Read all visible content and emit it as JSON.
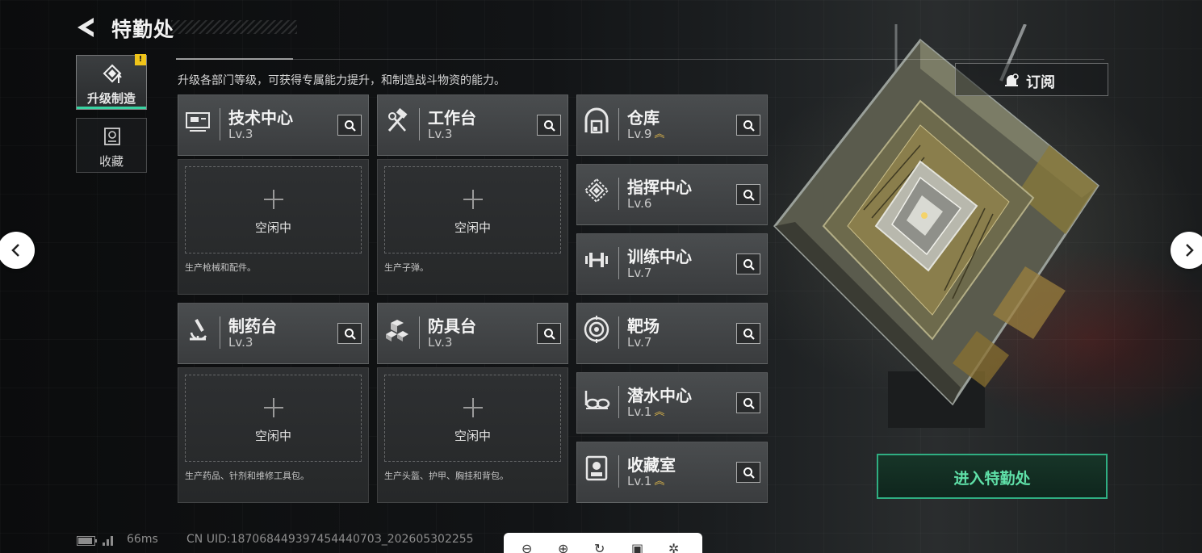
{
  "header": {
    "title": "特勤处",
    "back_icon": "back-chevron-icon"
  },
  "tabs": [
    {
      "label": "升级制造",
      "icon": "upgrade-build-icon",
      "active": true,
      "alert": "!"
    },
    {
      "label": "收藏",
      "icon": "collection-icon",
      "active": false
    }
  ],
  "subtitle": "升级各部门等级，可获得专属能力提升，和制造战斗物资的能力。",
  "production": [
    {
      "name": "技术中心",
      "level": "Lv.3",
      "icon": "computer-icon",
      "slot_status": "空闲中",
      "slot_desc": "生产枪械和配件。"
    },
    {
      "name": "工作台",
      "level": "Lv.3",
      "icon": "hammer-wrench-icon",
      "slot_status": "空闲中",
      "slot_desc": "生产子弹。"
    },
    {
      "name": "制药台",
      "level": "Lv.3",
      "icon": "microscope-icon",
      "slot_status": "空闲中",
      "slot_desc": "生产药品、针剂和维修工具包。"
    },
    {
      "name": "防具台",
      "level": "Lv.3",
      "icon": "armor-blocks-icon",
      "slot_status": "空闲中",
      "slot_desc": "生产头盔、护甲、胸挂和背包。"
    }
  ],
  "facilities": [
    {
      "name": "仓库",
      "level": "Lv.9",
      "icon": "warehouse-icon",
      "upgradable": true
    },
    {
      "name": "指挥中心",
      "level": "Lv.6",
      "icon": "command-center-icon",
      "upgradable": false
    },
    {
      "name": "训练中心",
      "level": "Lv.7",
      "icon": "dumbbell-icon",
      "upgradable": false
    },
    {
      "name": "靶场",
      "level": "Lv.7",
      "icon": "target-icon",
      "upgradable": false
    },
    {
      "name": "潜水中心",
      "level": "Lv.1",
      "icon": "diving-goggles-icon",
      "upgradable": true
    },
    {
      "name": "收藏室",
      "level": "Lv.1",
      "icon": "trophy-room-icon",
      "upgradable": true
    }
  ],
  "subscribe": {
    "label": "订阅",
    "icon": "subscribe-bell-icon"
  },
  "enter_button": {
    "label": "进入特勤处"
  },
  "status": {
    "ping": "66ms",
    "uid": "CN UID:18706844939745444070З_202605302255"
  },
  "colors": {
    "accent_green": "#39d3a2",
    "alert_yellow": "#f0c419",
    "upgrade_gold": "#e0b84a"
  }
}
